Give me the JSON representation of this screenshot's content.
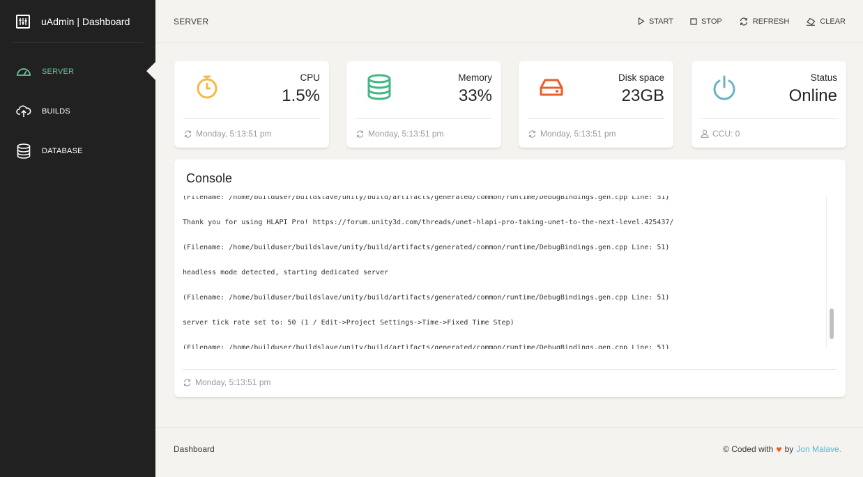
{
  "brand": {
    "title": "uAdmin | Dashboard"
  },
  "sidebar": {
    "items": [
      {
        "label": "SERVER",
        "icon": "speedometer-icon",
        "active": true
      },
      {
        "label": "BUILDS",
        "icon": "cloud-upload-icon",
        "active": false
      },
      {
        "label": "DATABASE",
        "icon": "database-icon",
        "active": false
      }
    ]
  },
  "header": {
    "title": "SERVER",
    "actions": [
      {
        "label": "START",
        "icon": "play-icon"
      },
      {
        "label": "STOP",
        "icon": "stop-icon"
      },
      {
        "label": "REFRESH",
        "icon": "refresh-icon"
      },
      {
        "label": "CLEAR",
        "icon": "eraser-icon"
      }
    ]
  },
  "stats": [
    {
      "label": "CPU",
      "value": "1.5%",
      "icon": "timer-icon",
      "color": "#f3bb45",
      "footer": "Monday, 5:13:51 pm",
      "footer_icon": "refresh-icon"
    },
    {
      "label": "Memory",
      "value": "33%",
      "icon": "database-icon",
      "color": "#41b883",
      "footer": "Monday, 5:13:51 pm",
      "footer_icon": "refresh-icon"
    },
    {
      "label": "Disk space",
      "value": "23GB",
      "icon": "harddrive-icon",
      "color": "#eb5e28",
      "footer": "Monday, 5:13:51 pm",
      "footer_icon": "refresh-icon"
    },
    {
      "label": "Status",
      "value": "Online",
      "icon": "power-icon",
      "color": "#68b3c8",
      "footer": "CCU: 0",
      "footer_icon": "user-icon"
    }
  ],
  "console": {
    "title": "Console",
    "lines": [
      "(Filename: /home/builduser/buildslave/unity/build/artifacts/generated/common/runtime/DebugBindings.gen.cpp Line: 51)",
      "Thank you for using HLAPI Pro! https://forum.unity3d.com/threads/unet-hlapi-pro-taking-unet-to-the-next-level.425437/",
      "(Filename: /home/builduser/buildslave/unity/build/artifacts/generated/common/runtime/DebugBindings.gen.cpp Line: 51)",
      "headless mode detected, starting dedicated server",
      "(Filename: /home/builduser/buildslave/unity/build/artifacts/generated/common/runtime/DebugBindings.gen.cpp Line: 51)",
      "server tick rate set to: 50 (1 / Edit->Project Settings->Time->Fixed Time Step)",
      "(Filename: /home/builduser/buildslave/unity/build/artifacts/generated/common/runtime/DebugBindings.gen.cpp Line: 51)"
    ],
    "footer": "Monday, 5:13:51 pm"
  },
  "footer": {
    "left": "Dashboard",
    "right_prefix": "© Coded with",
    "heart": "♥",
    "by": "by",
    "author": "Jon Malave."
  }
}
